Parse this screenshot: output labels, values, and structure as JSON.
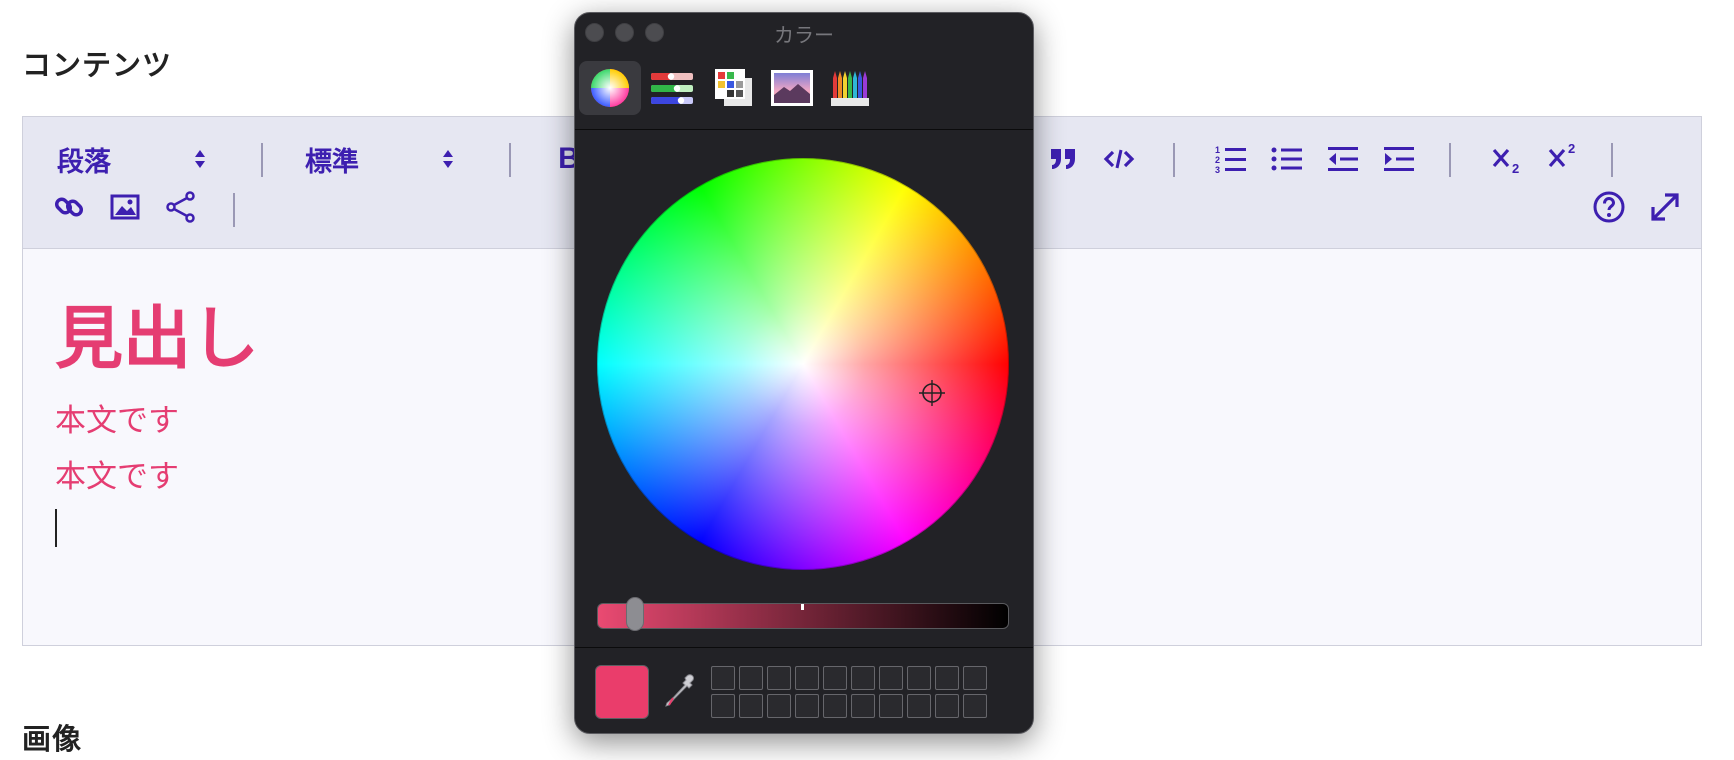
{
  "page": {
    "content_title": "コンテンツ",
    "image_title": "画像"
  },
  "toolbar": {
    "block_style": {
      "value": "段落"
    },
    "font_style": {
      "value": "標準"
    },
    "bold_label": "B",
    "accent_color": "#3d1fb0",
    "background": "#e6e7f2"
  },
  "document": {
    "heading": "見出し",
    "paragraphs": [
      "本文です",
      "本文です"
    ],
    "text_color": "#e53d72"
  },
  "color_panel": {
    "title": "カラー",
    "modes": [
      "color-wheel",
      "color-sliders",
      "color-palettes",
      "image-palettes",
      "pencils"
    ],
    "active_mode": "color-wheel",
    "current_color": "#ea3d6b",
    "brightness_level": 0.05,
    "swatch_slots": 20
  }
}
